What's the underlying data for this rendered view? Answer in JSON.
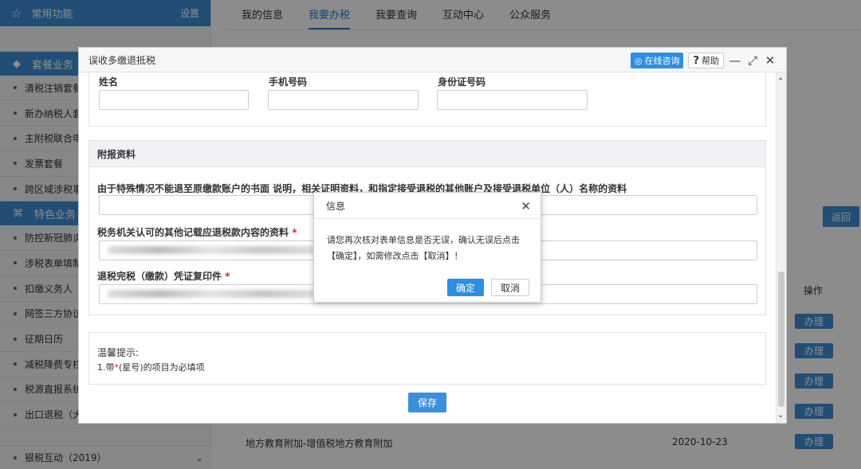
{
  "sidebar": {
    "header_title": "常用功能",
    "header_settings": "设置",
    "group1_title": "套餐业务",
    "group1_items": [
      "清税注销套餐",
      "新办纳税人套",
      "主附税联合申",
      "发票套餐",
      "跨区域涉税事"
    ],
    "group2_title": "特色业务",
    "group2_items": [
      "防控新冠肺炎",
      "涉税表单填制",
      "扣缴义务人（",
      "网签三方协议",
      "征期日历",
      "减税降费专栏",
      "税源直报系统",
      "出口退税（大"
    ],
    "last_item": "银税互动（2019）"
  },
  "topnav": {
    "tabs": [
      "我的信息",
      "我要办税",
      "我要查询",
      "互动中心",
      "公众服务"
    ],
    "active": "我要办税"
  },
  "background": {
    "back_label": "返回",
    "ops_header": "操作",
    "op_label": "办理",
    "row_name": "地方教育附加-增值税地方教育附加",
    "row_date": "2020-10-23"
  },
  "dialog": {
    "title": "误收多缴退抵税",
    "consult_label": "在线咨询",
    "help_label": "帮助",
    "fields": {
      "name_label": "姓名",
      "phone_label": "手机号码",
      "id_label": "身份证号码"
    },
    "attach_title": "附报资料",
    "attach_q1": "由于特殊情况不能退至原缴款账户的书面 说明，相关证明资料，和指定接受退税的其他账户及接受退税单位（人）名称的资料",
    "attach_q2": "税务机关认可的其他记载应退税款内容的资料",
    "attach_q3": "退税完税（缴款）凭证复印件",
    "required_mark": "*",
    "tips_title": "温馨提示:",
    "tips_line_prefix": "1.带",
    "tips_line_suffix": "(星号)的项目为必填项",
    "save_label": "保存"
  },
  "confirm": {
    "title": "信息",
    "message": "请您再次核对表单信息是否无误，确认无误后点击【确定】，如需修改点击【取消】！",
    "ok_label": "确定",
    "cancel_label": "取消"
  },
  "colors": {
    "primary": "#3f8fd8",
    "required": "#e02020"
  },
  "icons": [
    "star-icon",
    "layers-icon",
    "grid-icon",
    "chevron-down-icon",
    "headset-icon",
    "question-icon",
    "minimize-icon",
    "maximize-icon",
    "close-icon",
    "scroll-up-icon",
    "scroll-down-icon"
  ]
}
